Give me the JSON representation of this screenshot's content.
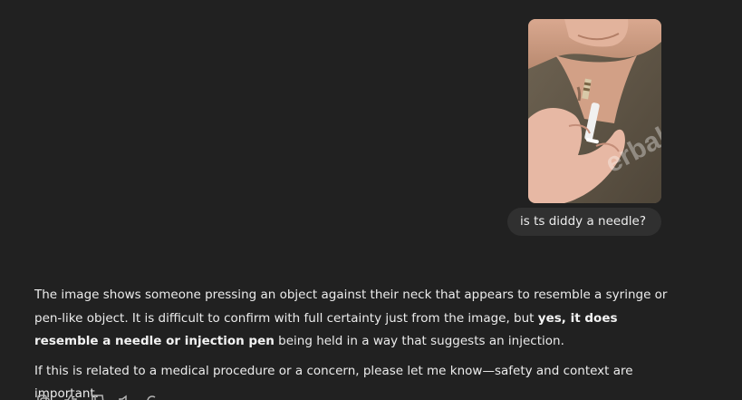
{
  "user_message": {
    "image_icon": "photo-neck-syringe",
    "watermark": "erbal",
    "text": "is ts diddy a needle?"
  },
  "assistant_message": {
    "p1_text_1": "The image shows someone pressing an object against their neck that appears to resemble a syringe or pen-like object. It is difficult to confirm with full certainty just from the image, but ",
    "p1_bold": "yes, it does resemble a needle or injection pen",
    "p1_text_2": " being held in a way that suggests an injection.",
    "p2_text": "If this is related to a medical procedure or a concern, please let me know—safety and context are important."
  },
  "actions": {
    "icons": [
      "copy-icon",
      "thumbs-up-icon",
      "thumbs-down-icon",
      "speaker-icon",
      "regenerate-icon"
    ]
  }
}
